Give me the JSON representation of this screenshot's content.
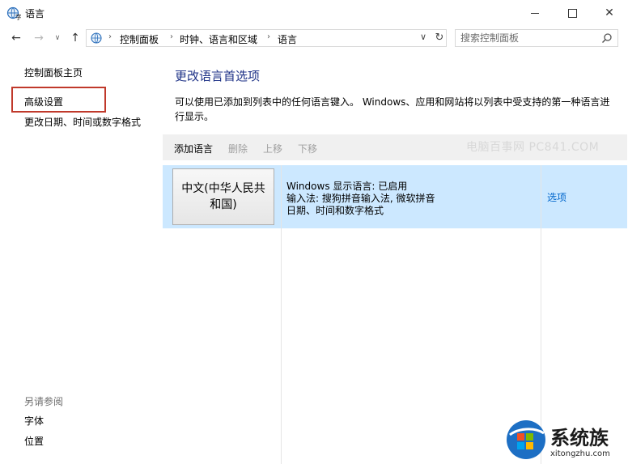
{
  "window": {
    "title": "语言",
    "minimize_icon": "minimize-icon",
    "maximize_icon": "maximize-icon",
    "close_icon": "close-icon"
  },
  "navigation": {
    "back_icon": "arrow-left-icon",
    "forward_icon": "arrow-right-icon",
    "recent_icon": "chevron-down-icon",
    "up_icon": "arrow-up-icon",
    "breadcrumb": [
      "控制面板",
      "时钟、语言和区域",
      "语言"
    ],
    "refresh_icon": "refresh-icon"
  },
  "search": {
    "placeholder": "搜索控制面板",
    "icon": "search-icon"
  },
  "sidebar": {
    "home": "控制面板主页",
    "advanced": "高级设置",
    "change_date": "更改日期、时间或数字格式",
    "see_also_title": "另请参阅",
    "fonts": "字体",
    "location": "位置"
  },
  "main": {
    "title": "更改语言首选项",
    "description": "可以使用已添加到列表中的任何语言键入。 Windows、应用和网站将以列表中受支持的第一种语言进行显示。"
  },
  "toolbar": {
    "add": "添加语言",
    "remove": "删除",
    "up": "上移",
    "down": "下移",
    "watermark": "电脑百事网 PC841.COM"
  },
  "languages": [
    {
      "name_line1": "中文(中华人民共",
      "name_line2": "和国)",
      "display_language": "Windows 显示语言: 已启用",
      "input_method": "输入法: 搜狗拼音输入法, 微软拼音",
      "formats": "日期、时间和数字格式",
      "options": "选项"
    }
  ],
  "branding": {
    "logo_text": "系统族",
    "url": "xitongzhu.com"
  },
  "colors": {
    "title_blue": "#1e3287",
    "selected_row": "#cce8ff",
    "link_blue": "#0066cc",
    "highlight_red": "#c0392b"
  }
}
